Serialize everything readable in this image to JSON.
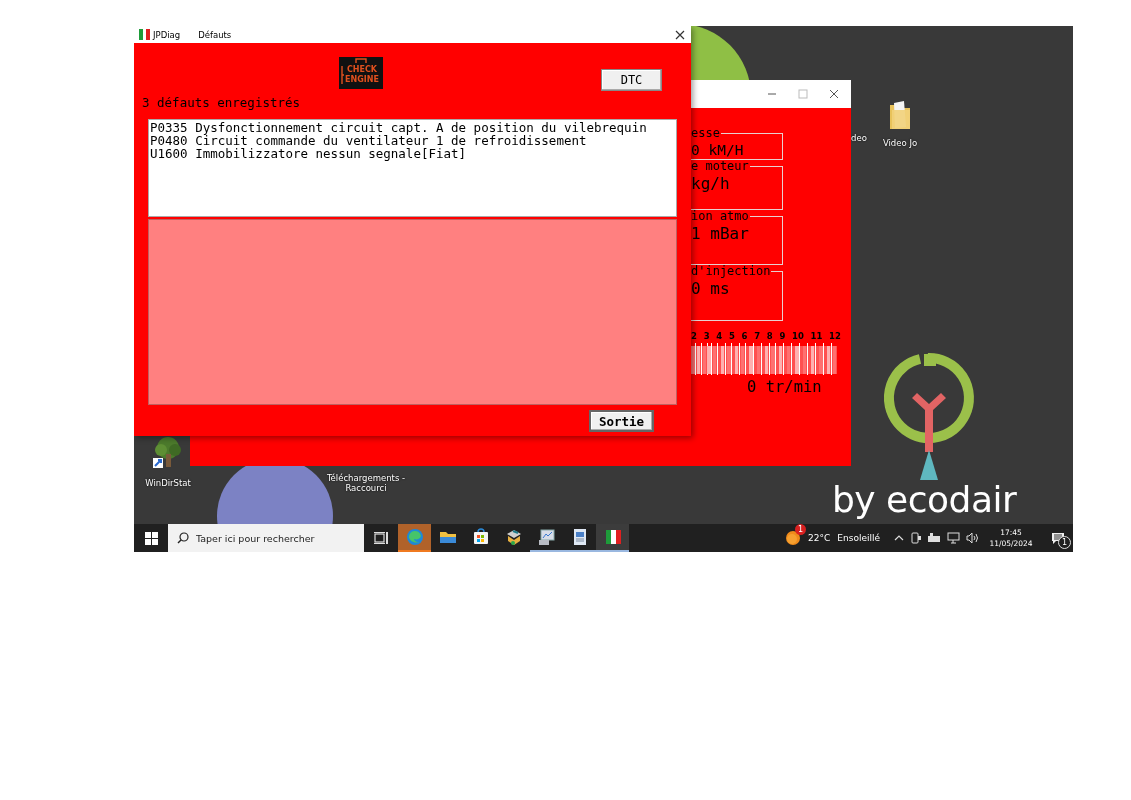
{
  "wallpaper": {
    "brand": "by ecodair"
  },
  "desktop_icons": [
    {
      "kind": "hidden",
      "label": "deo"
    },
    {
      "kind": "folder",
      "label": "Video Jo"
    },
    {
      "kind": "tree",
      "label": "WinDirStat"
    },
    {
      "kind": "hidden",
      "label": "Téléchargements - Raccourci"
    }
  ],
  "back_window": {
    "gauges": [
      {
        "label": "esse",
        "value": "0 kM/H"
      },
      {
        "label": "e moteur",
        "value": "kg/h"
      },
      {
        "label": "ion atmo",
        "value": "1 mBar"
      },
      {
        "label": "d'injection",
        "value": "0 ms"
      }
    ],
    "rpm_scale": [
      "2",
      "3",
      "4",
      "5",
      "6",
      "7",
      "8",
      "9",
      "10",
      "11",
      "12"
    ],
    "rpm_reading": "0 tr/min"
  },
  "window": {
    "title": "JPDiag",
    "menu": [
      "Défauts"
    ],
    "icon_text": [
      "CHECK",
      "ENGINE"
    ],
    "dtc_button": "DTC",
    "summary": "3 défauts enregistrés",
    "faults": [
      "P0335 Dysfonctionnement circuit capt. A de position du vilebrequin",
      "P0480 Circuit commande du ventilateur 1 de refroidissement",
      "U1600 Immobilizzatore nessun segnale[Fiat]"
    ],
    "exit_button": "Sortie"
  },
  "taskbar": {
    "search": {
      "placeholder": "Taper ici pour rechercher"
    },
    "apps": [
      {
        "kind": "edge",
        "running": false,
        "selected": false,
        "attention": true
      },
      {
        "kind": "folder",
        "running": false,
        "selected": false,
        "attention": false
      },
      {
        "kind": "store",
        "running": false,
        "selected": false,
        "attention": false
      },
      {
        "kind": "tool",
        "running": false,
        "selected": false,
        "attention": false
      },
      {
        "kind": "monitor",
        "running": true,
        "selected": false,
        "attention": false
      },
      {
        "kind": "document",
        "running": true,
        "selected": false,
        "attention": false
      },
      {
        "kind": "flag",
        "running": true,
        "selected": true,
        "attention": false
      }
    ],
    "weather": {
      "badge": "1",
      "temperature": "22°C",
      "condition": "Ensoleillé"
    },
    "clock": {
      "time": "17:45",
      "date": "11/05/2024"
    },
    "notifications": {
      "badge": "1"
    }
  }
}
